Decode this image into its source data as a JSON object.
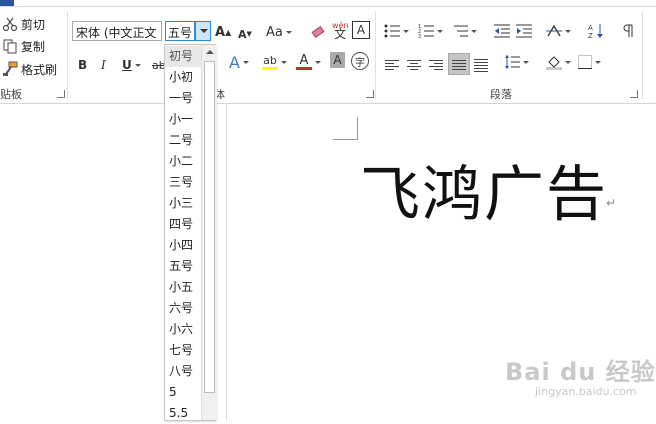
{
  "clipboard": {
    "cut_label": "剪切",
    "copy_label": "复制",
    "format_painter_label": "格式刷",
    "group_label": "贴板"
  },
  "font": {
    "font_name_value": "宋体 (中文正文",
    "font_size_value": "五号",
    "group_label": "体",
    "bold_label": "B",
    "italic_label": "I",
    "underline_label": "U",
    "strike_label": "ab",
    "grow_label": "A",
    "shrink_label": "A",
    "case_label": "Aa",
    "phonetic_label": "wén",
    "phonetic_char": "文",
    "border_char_label": "A",
    "effects_label": "A",
    "highlight_label": "ab",
    "font_color_label": "A",
    "shading_label": "A",
    "enclose_label": "字",
    "highlight_color": "#ffff00",
    "font_color": "#e02020"
  },
  "paragraph": {
    "group_label": "段落"
  },
  "size_dropdown": {
    "items": [
      "初号",
      "小初",
      "一号",
      "小一",
      "二号",
      "小二",
      "三号",
      "小三",
      "四号",
      "小四",
      "五号",
      "小五",
      "六号",
      "小六",
      "七号",
      "八号",
      "5",
      "5.5"
    ],
    "selected": "初号"
  },
  "document": {
    "text": "飞鸿广告",
    "paragraph_mark": "↵"
  },
  "watermark": {
    "main": "Bai du 经验",
    "sub": "jingyan.baidu.com"
  },
  "colors": {
    "accent": "#2b579a",
    "select_border": "#2a8ad4"
  }
}
